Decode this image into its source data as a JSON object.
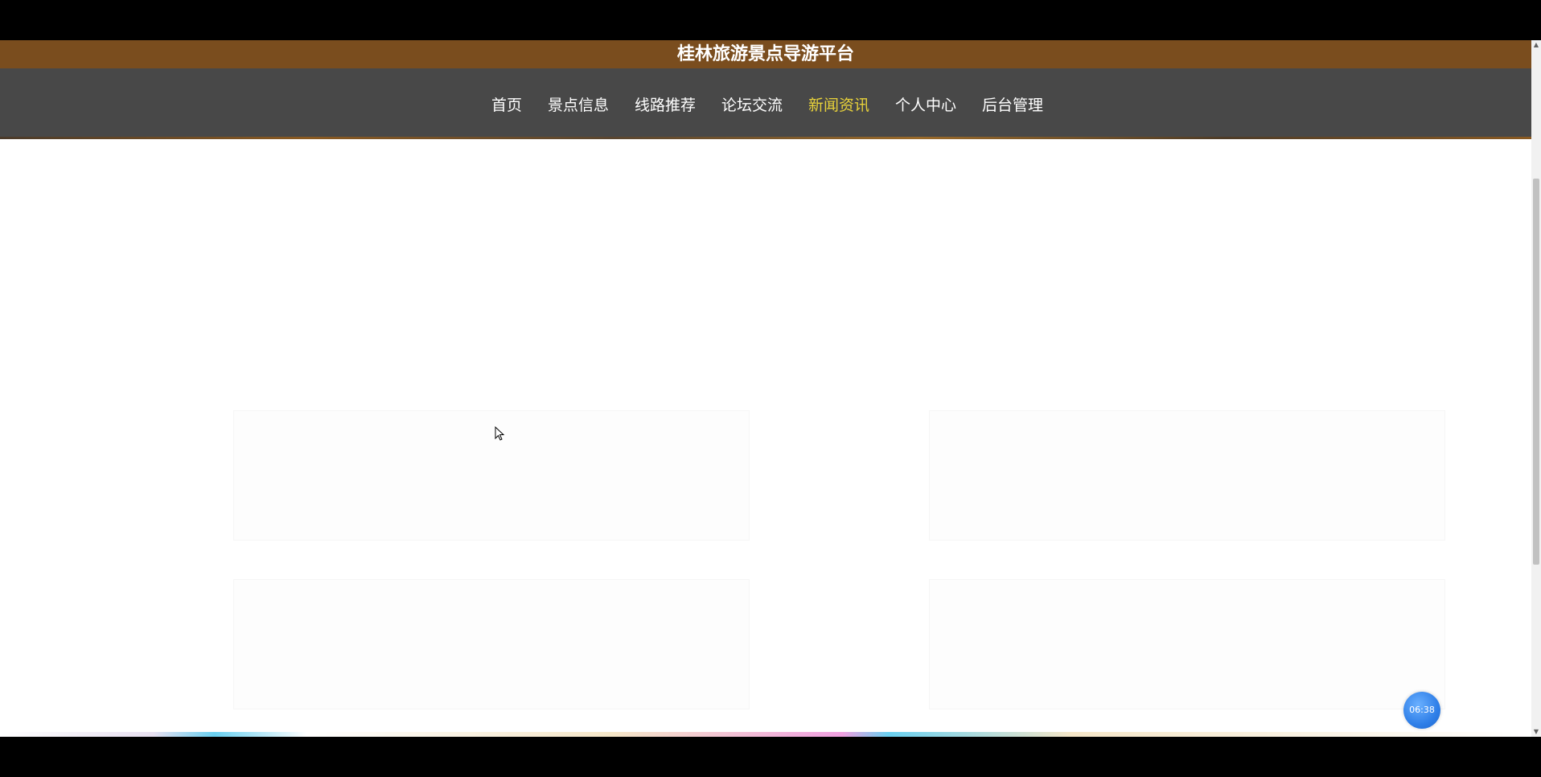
{
  "site": {
    "title": "桂林旅游景点导游平台"
  },
  "nav": {
    "items": [
      {
        "label": "首页",
        "active": false
      },
      {
        "label": "景点信息",
        "active": false
      },
      {
        "label": "线路推荐",
        "active": false
      },
      {
        "label": "论坛交流",
        "active": false
      },
      {
        "label": "新闻资讯",
        "active": true
      },
      {
        "label": "个人中心",
        "active": false
      },
      {
        "label": "后台管理",
        "active": false
      }
    ],
    "active_color": "#e8d23a"
  },
  "float_badge": {
    "text": "06:38"
  },
  "colors": {
    "title_bar": "#7a4d1e",
    "nav_bar": "#484848",
    "page_bg": "#ffffff"
  }
}
